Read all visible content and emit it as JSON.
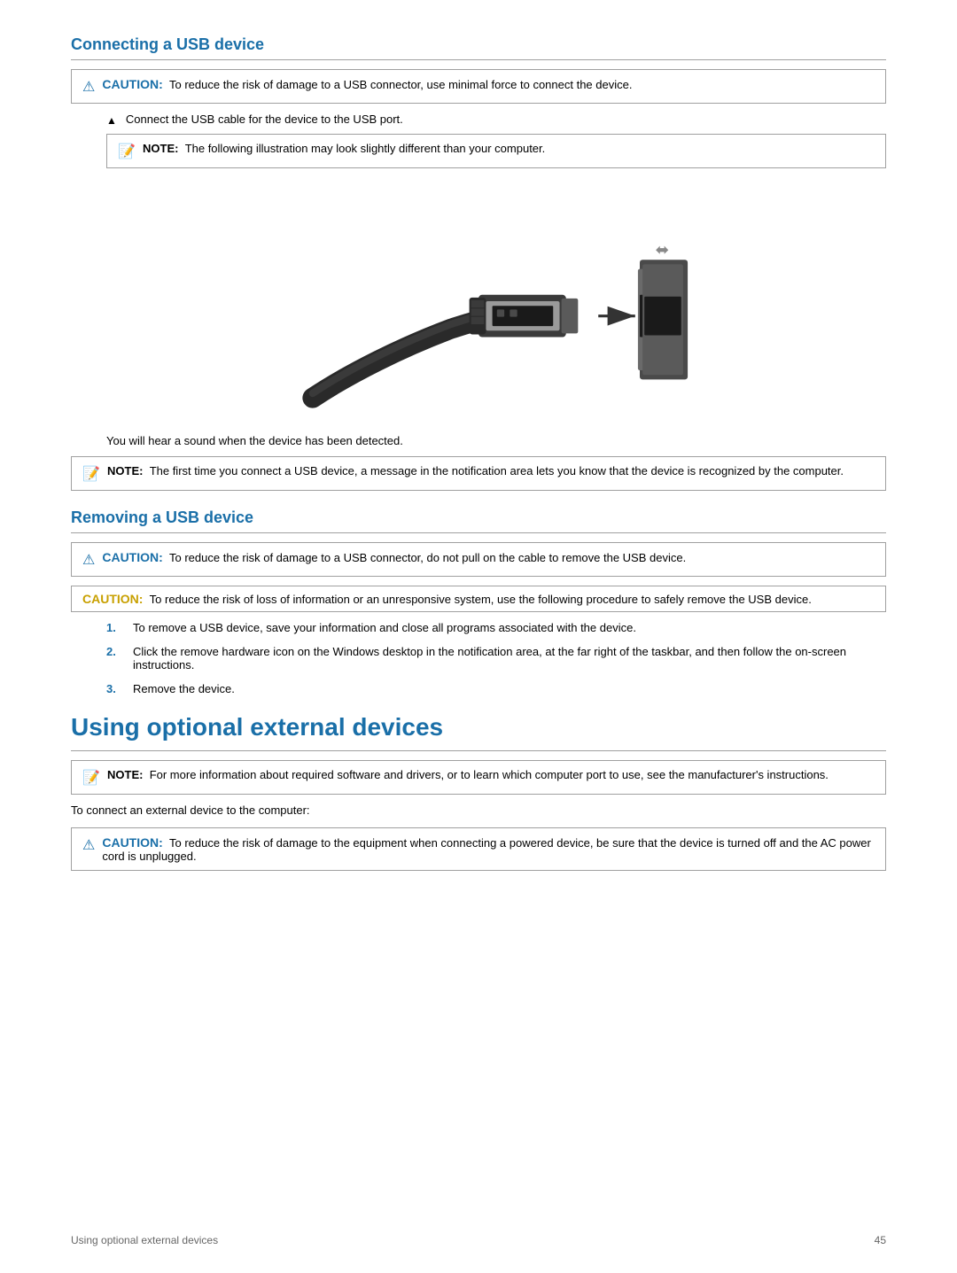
{
  "page": {
    "sections": [
      {
        "id": "connecting-usb",
        "heading": "Connecting a USB device",
        "caution1": {
          "label": "CAUTION:",
          "text": "To reduce the risk of damage to a USB connector, use minimal force to connect the device."
        },
        "bullet1": "Connect the USB cable for the device to the USB port.",
        "note1": {
          "label": "NOTE:",
          "text": "The following illustration may look slightly different than your computer."
        },
        "detection_text": "You will hear a sound when the device has been detected.",
        "note2": {
          "label": "NOTE:",
          "text": "The first time you connect a USB device, a message in the notification area lets you know that the device is recognized by the computer."
        }
      },
      {
        "id": "removing-usb",
        "heading": "Removing a USB device",
        "caution1": {
          "label": "CAUTION:",
          "text": "To reduce the risk of damage to a USB connector, do not pull on the cable to remove the USB device."
        },
        "caution2": {
          "label": "CAUTION:",
          "text": "To reduce the risk of loss of information or an unresponsive system, use the following procedure to safely remove the USB device."
        },
        "steps": [
          "To remove a USB device, save your information and close all programs associated with the device.",
          "Click the remove hardware icon on the Windows desktop in the notification area, at the far right of the taskbar, and then follow the on-screen instructions.",
          "Remove the device."
        ]
      },
      {
        "id": "using-optional",
        "heading": "Using optional external devices",
        "note1": {
          "label": "NOTE:",
          "text": "For more information about required software and drivers, or to learn which computer port to use, see the manufacturer's instructions."
        },
        "body_text": "To connect an external device to the computer:",
        "caution1": {
          "label": "CAUTION:",
          "text": "To reduce the risk of damage to the equipment when connecting a powered device, be sure that the device is turned off and the AC power cord is unplugged."
        }
      }
    ],
    "footer": {
      "left": "Using optional external devices",
      "right": "45"
    }
  }
}
